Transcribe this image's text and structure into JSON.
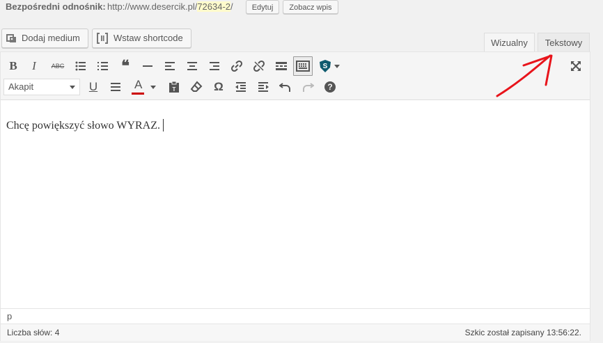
{
  "permalink": {
    "label": "Bezpośredni odnośnik:",
    "url_base": "http://www.desercik.pl/",
    "slug": "72634-2",
    "url_tail": "/",
    "edit_button": "Edytuj",
    "view_button": "Zobacz wpis"
  },
  "media": {
    "add_media": "Dodaj medium",
    "insert_shortcode": "Wstaw shortcode"
  },
  "tabs": {
    "visual": "Wizualny",
    "text": "Tekstowy"
  },
  "toolbar": {
    "format_value": "Akapit",
    "row1_icons": [
      "bold-icon",
      "italic-icon",
      "strikethrough-icon",
      "bulleted-list-icon",
      "numbered-list-icon",
      "blockquote-icon",
      "horizontal-line-icon",
      "align-left-icon",
      "align-center-icon",
      "align-right-icon",
      "link-icon",
      "unlink-icon",
      "read-more-icon",
      "toolbar-toggle-icon",
      "shortcode-plugin-icon",
      "dropdown-icon",
      "fullscreen-icon"
    ],
    "row2_icons": [
      "underline-icon",
      "justify-icon",
      "text-color-icon",
      "color-dropdown-icon",
      "paste-as-text-icon",
      "clear-formatting-icon",
      "special-character-icon",
      "outdent-icon",
      "indent-icon",
      "undo-icon",
      "redo-icon",
      "help-icon"
    ],
    "bold_glyph": "B",
    "italic_glyph": "I",
    "strike_glyph": "ABC",
    "underline_glyph": "U",
    "color_glyph": "A",
    "omega_glyph": "Ω",
    "help_glyph": "?",
    "quote_glyph": "❝"
  },
  "content": {
    "text": "Chcę powiększyć słowo WYRAZ."
  },
  "path": "p",
  "status": {
    "word_count": "Liczba słów: 4",
    "draft_saved": "Szkic został zapisany 13:56:22."
  },
  "colors": {
    "annotation": "#e8141b",
    "text_color_bar": "#cc0000",
    "shortcode_icon": "#0e5a6e"
  }
}
